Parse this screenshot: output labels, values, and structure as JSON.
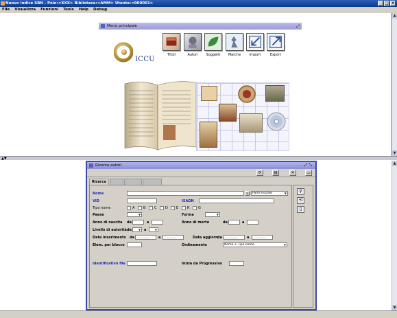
{
  "window": {
    "title": "Nuovo indice SBN - Polo:<XXX> Biblioteca:<AMM> Utente:<000001>"
  },
  "menubar": [
    "File",
    "Visualizza",
    "Funzioni",
    "Tools",
    "Help",
    "Debug"
  ],
  "menu_principale": {
    "title": "Menù principale",
    "logo_text": "ICCU",
    "tools": [
      {
        "label": "Titoli",
        "icon": "book-icon"
      },
      {
        "label": "Autori",
        "icon": "author-icon"
      },
      {
        "label": "Soggetti",
        "icon": "leaf-icon"
      },
      {
        "label": "Marche",
        "icon": "mark-icon"
      },
      {
        "label": "Import",
        "icon": "import-icon"
      },
      {
        "label": "Export",
        "icon": "export-icon"
      }
    ]
  },
  "ricerca_autori": {
    "title": "Ricerca autori",
    "tabs": [
      "Ricerca",
      "",
      "",
      ""
    ],
    "fields": {
      "nome": "Nome",
      "nome_option": "Parte Iniziale",
      "vid": "VID",
      "isadn": "ISADN",
      "tipo_nome": "Tipo nome",
      "tipo_options": [
        "A",
        "B",
        "C",
        "D",
        "E",
        "R",
        "G"
      ],
      "paese": "Paese",
      "forma": "Forma",
      "anno_nascita": "Anno di nascita",
      "anno_morte": "Anno di morte",
      "livello_autorita": "Livello di autorità",
      "data_inserimento": "Data inserimento",
      "data_aggiorn": "Data aggiorn.",
      "elem_blocco": "Elem. per blocco",
      "ordinamento": "Ordinamento",
      "ordinamento_value": "Nome + Tipo nome",
      "identificativo_file": "Identificativo file",
      "inizia_progressivo": "Inizia da Progressivo",
      "da": "da",
      "a": "a",
      "date_placeholder": "_._._____"
    }
  },
  "colors": {
    "titlebar": "#0a3a8c",
    "frame_border": "#3a4aa8",
    "link_blue": "#1a2ab8"
  }
}
